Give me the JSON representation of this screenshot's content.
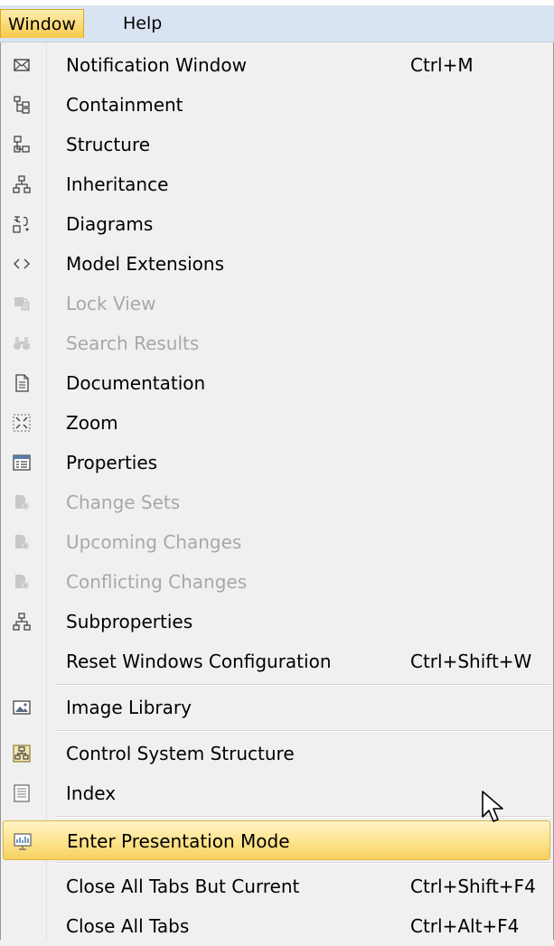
{
  "menubar": {
    "items": [
      {
        "label": "Window"
      },
      {
        "label": "Help"
      }
    ]
  },
  "menu": {
    "items": [
      {
        "label": "Notification Window",
        "shortcut": "Ctrl+M",
        "icon": "envelope-icon",
        "enabled": true
      },
      {
        "label": "Containment",
        "icon": "containment-tree-icon",
        "enabled": true
      },
      {
        "label": "Structure",
        "icon": "structure-tree-icon",
        "enabled": true
      },
      {
        "label": "Inheritance",
        "icon": "hierarchy-icon",
        "enabled": true
      },
      {
        "label": "Diagrams",
        "icon": "diagrams-icon",
        "enabled": true
      },
      {
        "label": "Model Extensions",
        "icon": "angle-brackets-icon",
        "enabled": true
      },
      {
        "label": "Lock View",
        "icon": "lock-view-icon",
        "enabled": false
      },
      {
        "label": "Search Results",
        "icon": "binoculars-icon",
        "enabled": false
      },
      {
        "label": "Documentation",
        "icon": "document-icon",
        "enabled": true
      },
      {
        "label": "Zoom",
        "icon": "zoom-frame-icon",
        "enabled": true
      },
      {
        "label": "Properties",
        "icon": "properties-table-icon",
        "enabled": true
      },
      {
        "label": "Change Sets",
        "icon": "change-sets-icon",
        "enabled": false
      },
      {
        "label": "Upcoming Changes",
        "icon": "change-sets-icon",
        "enabled": false
      },
      {
        "label": "Conflicting Changes",
        "icon": "change-sets-icon",
        "enabled": false
      },
      {
        "label": "Subproperties",
        "icon": "hierarchy-icon",
        "enabled": true
      },
      {
        "label": "Reset Windows Configuration",
        "shortcut": "Ctrl+Shift+W",
        "icon": "",
        "enabled": true
      },
      {
        "label": "Image Library",
        "icon": "image-icon",
        "enabled": true
      },
      {
        "label": "Control System Structure",
        "icon": "control-system-icon",
        "enabled": true
      },
      {
        "label": "Index",
        "icon": "index-document-icon",
        "enabled": true
      },
      {
        "label": "Enter Presentation Mode",
        "icon": "presentation-icon",
        "enabled": true,
        "highlighted": true
      },
      {
        "label": "Close All Tabs But Current",
        "shortcut": "Ctrl+Shift+F4",
        "icon": "",
        "enabled": true
      },
      {
        "label": "Close All Tabs",
        "shortcut": "Ctrl+Alt+F4",
        "icon": "",
        "enabled": true
      }
    ]
  },
  "colors": {
    "menubar_bg": "#d9e4f2",
    "highlight": "#fde38c",
    "disabled_text": "#a8a8a8"
  }
}
